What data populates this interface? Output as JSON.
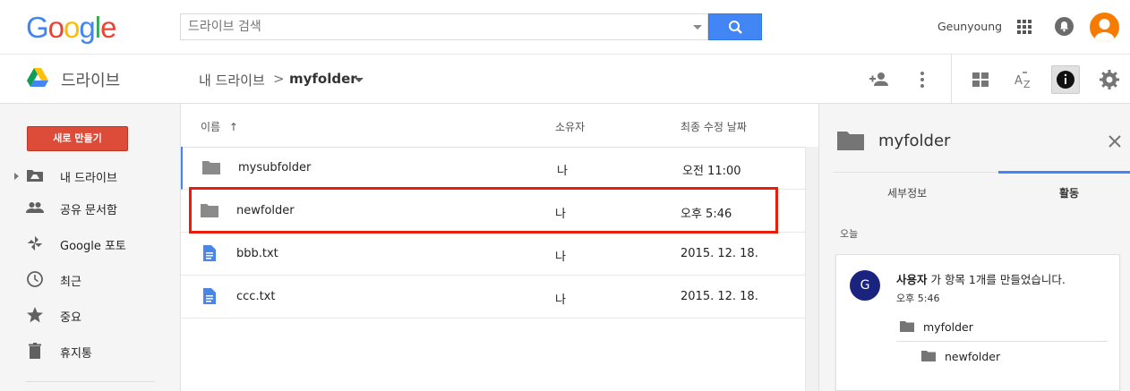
{
  "header": {
    "logo_letters": [
      {
        "ch": "G",
        "color": "#4285f4"
      },
      {
        "ch": "o",
        "color": "#ea4335"
      },
      {
        "ch": "o",
        "color": "#fbbc05"
      },
      {
        "ch": "g",
        "color": "#4285f4"
      },
      {
        "ch": "l",
        "color": "#34a853"
      },
      {
        "ch": "e",
        "color": "#ea4335"
      }
    ],
    "search_placeholder": "드라이브 검색",
    "user_name": "Geunyoung",
    "icons": [
      "search-icon",
      "apps-icon",
      "notifications-icon",
      "avatar"
    ]
  },
  "toolbar": {
    "app_title": "드라이브",
    "breadcrumb_root": "내 드라이브",
    "breadcrumb_separator": ">",
    "breadcrumb_current": "myfolder",
    "icons": [
      "add-person-icon",
      "more-vert-icon",
      "grid-view-icon",
      "sort-az-icon",
      "info-icon",
      "settings-icon"
    ]
  },
  "sidebar": {
    "new_button": "새로 만들기",
    "items": [
      {
        "label": "내 드라이브",
        "icon": "my-drive-icon"
      },
      {
        "label": "공유 문서함",
        "icon": "shared-people-icon"
      },
      {
        "label": "Google 포토",
        "icon": "photos-pinwheel-icon"
      },
      {
        "label": "최근",
        "icon": "clock-icon"
      },
      {
        "label": "중요",
        "icon": "star-icon"
      },
      {
        "label": "휴지통",
        "icon": "trash-icon"
      }
    ]
  },
  "file_list": {
    "columns": {
      "name": "이름",
      "sort_arrow": "↑",
      "owner": "소유자",
      "modified": "최종 수정 날짜"
    },
    "rows": [
      {
        "name": "mysubfolder",
        "type": "folder",
        "owner": "나",
        "modified": "오전 11:00"
      },
      {
        "name": "newfolder",
        "type": "folder",
        "owner": "나",
        "modified": "오후 5:46"
      },
      {
        "name": "bbb.txt",
        "type": "doc",
        "owner": "나",
        "modified": "2015. 12. 18."
      },
      {
        "name": "ccc.txt",
        "type": "doc",
        "owner": "나",
        "modified": "2015. 12. 18."
      }
    ]
  },
  "details_panel": {
    "title": "myfolder",
    "tabs": [
      "세부정보",
      "활동"
    ],
    "active_tab": "활동",
    "section_label": "오늘",
    "activity": {
      "avatar_letter": "G",
      "actor": "사용자",
      "action": " 가 항목 1개를 만들었습니다.",
      "time": "오후 5:46",
      "parent_folder": "myfolder",
      "child_folder": "newfolder"
    }
  },
  "colors": {
    "accent_blue": "#4285f4",
    "new_button_red": "#dd4b39",
    "highlight_red": "#ea1d0b",
    "avatar_orange": "#f57c00",
    "activity_avatar": "#1a237e"
  }
}
